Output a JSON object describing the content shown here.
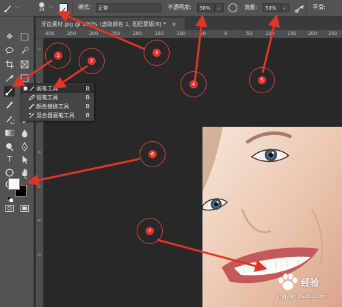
{
  "options_bar": {
    "brush_size": "24",
    "mode_label": "模式:",
    "mode_value": "正常",
    "opacity_label": "不透明度:",
    "opacity_value": "50%",
    "flow_label": "流量:",
    "flow_value": "50%",
    "smoothing_label": "平滑:"
  },
  "document_tab": {
    "title": "牙齿素材.jpg @ 100% (选取颜色 1, 图层蒙版/8) *",
    "close": "×"
  },
  "ruler": {
    "ticks": [
      "400",
      "350",
      "300",
      "250",
      "200",
      "150",
      "100",
      "50",
      "0",
      "50",
      "100",
      "150",
      "200",
      "250"
    ]
  },
  "vertical_ruler": {
    "ticks": [
      "1",
      "0",
      "0",
      "0",
      "0",
      "0",
      "0"
    ]
  },
  "flyout_menu": {
    "items": [
      {
        "label": "画笔工具",
        "shortcut": "B",
        "selected": true
      },
      {
        "label": "铅笔工具",
        "shortcut": "B",
        "selected": false
      },
      {
        "label": "颜色替换工具",
        "shortcut": "B",
        "selected": false
      },
      {
        "label": "混合器画笔工具",
        "shortcut": "B",
        "selected": false
      }
    ]
  },
  "annotations": [
    "1",
    "2",
    "3",
    "4",
    "5",
    "6",
    "7"
  ],
  "watermark": {
    "text": "经验",
    "url": "jingyan.baidu.com"
  },
  "colors": {
    "accent": "#e0352b",
    "panel": "#535353",
    "canvas": "#282828"
  }
}
